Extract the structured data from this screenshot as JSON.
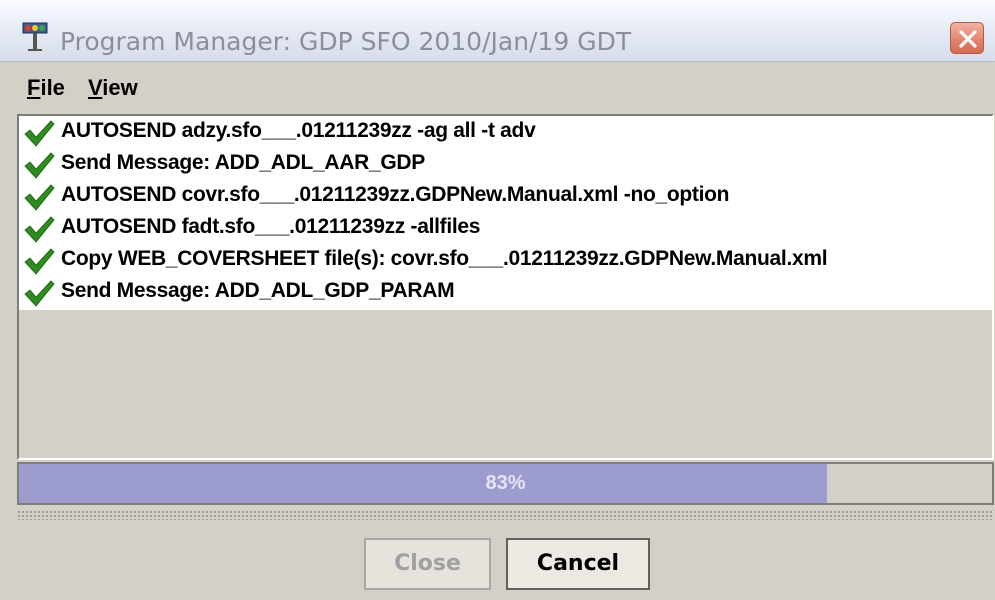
{
  "window": {
    "title": "Program Manager: GDP SFO 2010/Jan/19 GDT",
    "app_icon": "traffic-light-icon",
    "close_icon": "close-x-icon"
  },
  "menu": {
    "items": [
      {
        "label": "File",
        "mnemonic": "F"
      },
      {
        "label": "View",
        "mnemonic": "V"
      }
    ]
  },
  "tasks": [
    {
      "label": "AUTOSEND adzy.sfo___.01211239zz -ag all -t adv",
      "status": "done",
      "icon": "checkmark-icon"
    },
    {
      "label": "Send Message: ADD_ADL_AAR_GDP",
      "status": "done",
      "icon": "checkmark-icon"
    },
    {
      "label": "AUTOSEND covr.sfo___.01211239zz.GDPNew.Manual.xml -no_option",
      "status": "done",
      "icon": "checkmark-icon"
    },
    {
      "label": "AUTOSEND fadt.sfo___.01211239zz -allfiles",
      "status": "done",
      "icon": "checkmark-icon"
    },
    {
      "label": "Copy WEB_COVERSHEET file(s): covr.sfo___.01211239zz.GDPNew.Manual.xml",
      "status": "done",
      "icon": "checkmark-icon"
    },
    {
      "label": "Send Message: ADD_ADL_GDP_PARAM",
      "status": "done",
      "icon": "checkmark-icon"
    }
  ],
  "progress": {
    "value": 0.83,
    "text": "83%"
  },
  "buttons": {
    "close": {
      "label": "Close",
      "enabled": false
    },
    "cancel": {
      "label": "Cancel",
      "enabled": true
    }
  },
  "colors": {
    "check": "#2e8b1e",
    "progress_fill": "#9c9ccf",
    "title_bar": "#e7ecf6",
    "close_button": "#e38670"
  }
}
